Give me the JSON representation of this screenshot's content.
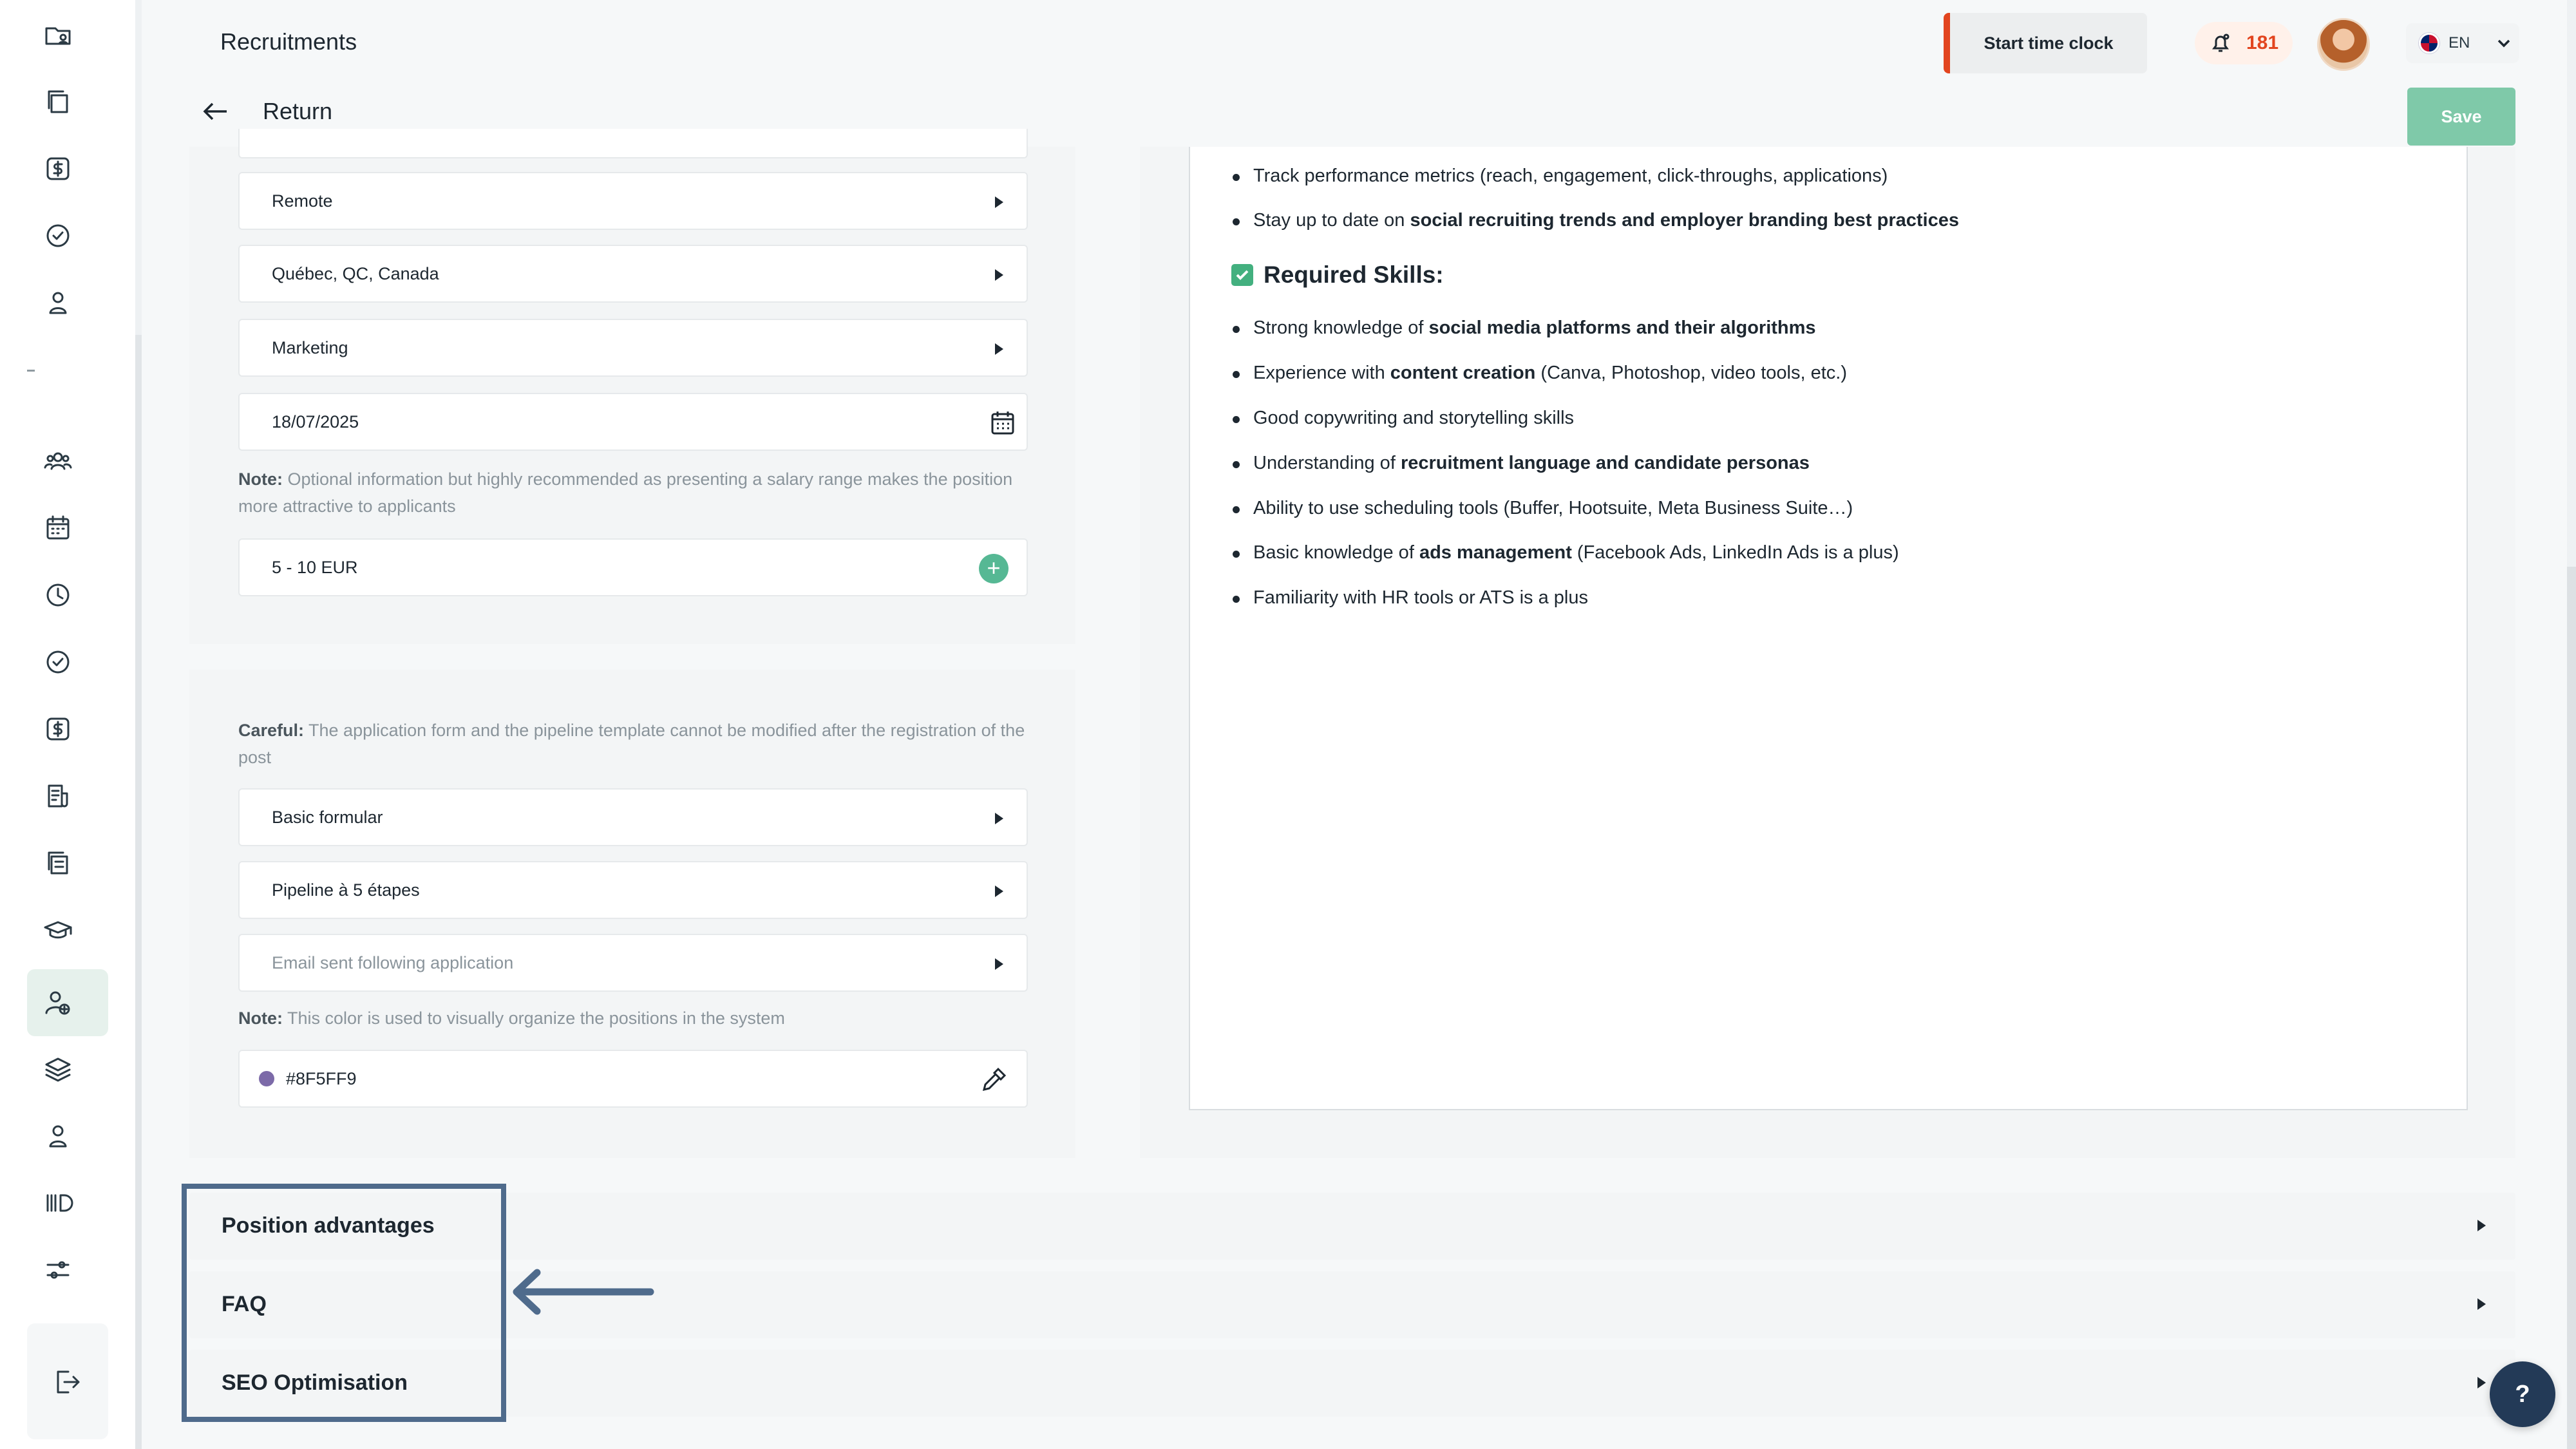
{
  "header": {
    "title": "Recruitments",
    "return_label": "Return",
    "clock_button": "Start time clock",
    "notification_count": "181",
    "language": "EN",
    "save_label": "Save"
  },
  "form": {
    "top_partial": "",
    "work_mode": "Remote",
    "location": "Québec, QC, Canada",
    "department": "Marketing",
    "date": "18/07/2025",
    "salary_note_label": "Note:",
    "salary_note_text": "Optional information but highly recommended as presenting a salary range makes the position more attractive to applicants",
    "salary": "5 - 10 EUR",
    "careful_label": "Careful:",
    "careful_text": "The application form and the pipeline template cannot be modified after the registration of the post",
    "application_form": "Basic formular",
    "pipeline": "Pipeline à 5 étapes",
    "email_placeholder": "Email sent following application",
    "color_note_label": "Note:",
    "color_note_text": "This color is used to visually organize the positions in the system",
    "color_value": "#8F5FF9"
  },
  "editor": {
    "bullets_top": [
      {
        "plain": "Track performance metrics (reach, engagement, click-throughs, applications)",
        "bold": "",
        "rest": ""
      },
      {
        "plain": "Stay up to date on ",
        "bold": "social recruiting trends and employer branding best practices",
        "rest": ""
      }
    ],
    "required_heading": "Required Skills:",
    "skills": [
      {
        "plain": "Strong knowledge of ",
        "bold": "social media platforms and their algorithms",
        "rest": ""
      },
      {
        "plain": "Experience with ",
        "bold": "content creation",
        "rest": " (Canva, Photoshop, video tools, etc.)"
      },
      {
        "plain": "Good copywriting and storytelling skills",
        "bold": "",
        "rest": ""
      },
      {
        "plain": "Understanding of ",
        "bold": "recruitment language and candidate personas",
        "rest": ""
      },
      {
        "plain": "Ability to use scheduling tools (Buffer, Hootsuite, Meta Business Suite…)",
        "bold": "",
        "rest": ""
      },
      {
        "plain": "Basic knowledge of ",
        "bold": "ads management",
        "rest": " (Facebook Ads, LinkedIn Ads is a plus)"
      },
      {
        "plain": "Familiarity with HR tools or ATS is a plus",
        "bold": "",
        "rest": ""
      }
    ]
  },
  "accordions": [
    {
      "label": "Position advantages"
    },
    {
      "label": "FAQ"
    },
    {
      "label": "SEO Optimisation"
    }
  ],
  "help_label": "?",
  "colors": {
    "accent_green": "#56b894",
    "clock_accent": "#e2451f",
    "highlight": "#4f6b8c",
    "position_color": "#8F5FF9"
  }
}
